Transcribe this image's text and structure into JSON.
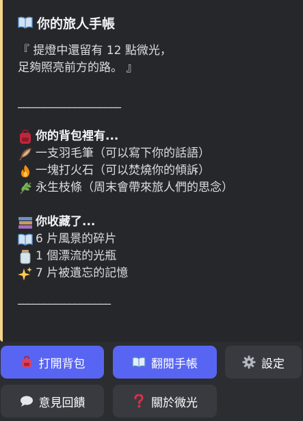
{
  "embed": {
    "title": "你的旅人手帳",
    "intro_line1": "『 提燈中還留有 12 點微光，",
    "intro_line2": "足夠照亮前方的路。 』",
    "divider1": "____________________",
    "backpack_header": "你的背包裡有...",
    "items": [
      {
        "icon": "feather-icon",
        "text": "一支羽毛筆（可以寫下你的話語）"
      },
      {
        "icon": "fire-icon",
        "text": "一塊打火石（可以焚燒你的傾訴）"
      },
      {
        "icon": "herb-icon",
        "text": "永生枝條（周末會帶來旅人們的思念）"
      }
    ],
    "collection_header": "你收藏了...",
    "collections": [
      {
        "icon": "open-book-icon",
        "text": "6 片風景的碎片"
      },
      {
        "icon": "jar-icon",
        "text": "1 個漂流的光瓶"
      },
      {
        "icon": "sparkles-icon",
        "text": "7 片被遺忘的記憶"
      }
    ],
    "divider2": "__________________",
    "accent_color": "#f5d58a"
  },
  "buttons": {
    "open_backpack": "打開背包",
    "read_journal": "翻閱手帳",
    "settings": "設定",
    "feedback": "意見回饋",
    "about": "關於微光"
  },
  "colors": {
    "primary": "#5865f2",
    "secondary": "#383a40",
    "background": "#2b2d31"
  }
}
